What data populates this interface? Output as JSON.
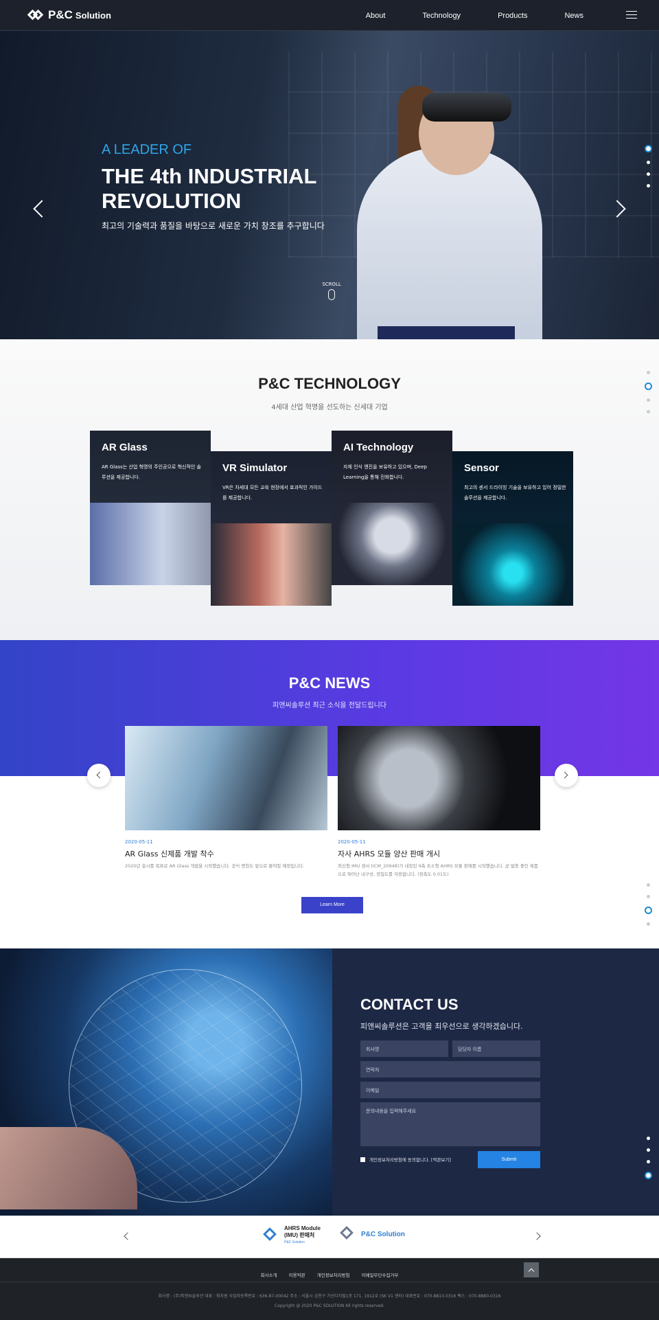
{
  "header": {
    "logo_text": "P&C",
    "logo_sub": "Solution",
    "nav": [
      "About",
      "Technology",
      "Products",
      "News"
    ]
  },
  "hero": {
    "tag": "A LEADER OF",
    "title": "THE 4th INDUSTRIAL REVOLUTION",
    "subtitle": "최고의 기술력과 품질을 바탕으로 새로운 가치 창조를 추구합니다",
    "scroll": "SCROLL",
    "active_slide": 1,
    "slide_count": 4
  },
  "technology": {
    "title": "P&C TECHNOLOGY",
    "subtitle": "4세대 산업 혁명을 선도하는 신세대 기업",
    "cards": [
      {
        "title": "AR Glass",
        "desc": "AR Glass는 산업 혁명의 주인공으로 혁신적인 솔루션을 제공합니다."
      },
      {
        "title": "VR Simulator",
        "desc": "VR은 차세대 모든 교육 현장에서 효과적인 가이드를 제공합니다."
      },
      {
        "title": "AI Technology",
        "desc": "자체 인식 엔진을 보유하고 있으며, Deep Learning을 통해 진화합니다."
      },
      {
        "title": "Sensor",
        "desc": "최고의 센서 드라이빙 기술을 보유하고 있어 정밀한 솔루션을 제공합니다."
      }
    ]
  },
  "news": {
    "title": "P&C NEWS",
    "subtitle": "피앤씨솔루션 최근 소식을 전달드립니다",
    "items": [
      {
        "date": "2020-05-11",
        "title": "AR Glass 신제품 개발 착수",
        "desc": "2020년 출시를 목표로 AR Glass 개발을 시작했습니다. 공식 명칭도 앞으로 붙여질 예정입니다."
      },
      {
        "date": "2020-05-11",
        "title": "자사 AHRS 모듈 양산 판매 개시",
        "desc": "최신형 IMU 센서 (ICM_20948)가 내장된 9축 초소형 AHRS 모듈 판매를 시작했습니다. 균 발충 좋인 제품으로 뛰어난 내구성, 정밀도를 자랑합니다. (정측도 0.01도)"
      }
    ],
    "more": "Learn More"
  },
  "contact": {
    "title": "CONTACT US",
    "subtitle": "피앤씨솔루션은 고객을 최우선으로 생각하겠습니다.",
    "fields": {
      "company": "회사명",
      "person": "담당자 이름",
      "phone": "연락처",
      "email": "이메일",
      "message": "문의내용을 입력해주세요"
    },
    "agree": "개인정보처리방침에 동의합니다. [약관보기]",
    "submit": "Submit"
  },
  "partners": {
    "p1_line1": "AHRS Module",
    "p1_line2": "(IMU) 판매처",
    "p1_small": "P&C Solution",
    "p2": "P&C Solution"
  },
  "footer": {
    "links": [
      "회사소개",
      "이용약관",
      "개인정보처리방침",
      "이메일무단수집거부"
    ],
    "info": "회사명 : (주)피앤씨솔루션   대표 : 최차원   사업자등록번호 : 636-87-00042   주소 : 서울시 금천구 가산디지털1로 171, 1912호 (SK V1 센터)   대표번호 : 070-8813-0316   팩스 : 070-8880-0316",
    "copyright": "Copyright @ 2020 P&C SOLUTION All rights reserved."
  }
}
